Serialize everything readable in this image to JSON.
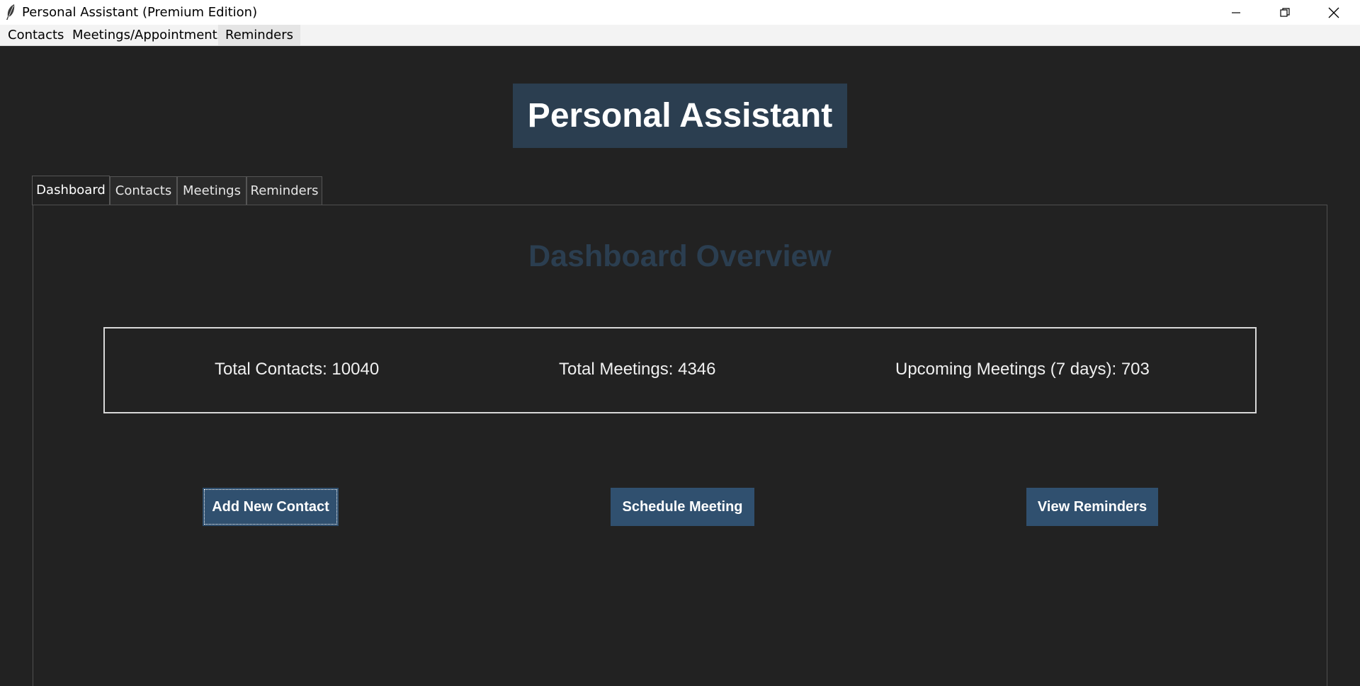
{
  "window": {
    "title": "Personal Assistant (Premium Edition)",
    "icon": "feather-icon"
  },
  "menubar": {
    "items": [
      {
        "label": "Contacts"
      },
      {
        "label": "Meetings/Appointments"
      },
      {
        "label": "Reminders"
      }
    ]
  },
  "header": {
    "title": "Personal Assistant",
    "background": "#2b3e50"
  },
  "tabs": [
    {
      "label": "Dashboard",
      "selected": true
    },
    {
      "label": "Contacts",
      "selected": false
    },
    {
      "label": "Meetings",
      "selected": false
    },
    {
      "label": "Reminders",
      "selected": false
    }
  ],
  "dashboard": {
    "title": "Dashboard Overview",
    "stats": {
      "contacts_label": "Total Contacts:",
      "contacts_value": "10040",
      "meetings_label": "Total Meetings:",
      "meetings_value": "4346",
      "upcoming_label": "Upcoming Meetings (7 days):",
      "upcoming_value": "703"
    },
    "actions": {
      "add_contact": "Add New Contact",
      "schedule_meeting": "Schedule Meeting",
      "view_reminders": "View Reminders"
    },
    "button_color": "#30506f"
  },
  "colors": {
    "background": "#222222",
    "accent": "#2b3e50"
  }
}
